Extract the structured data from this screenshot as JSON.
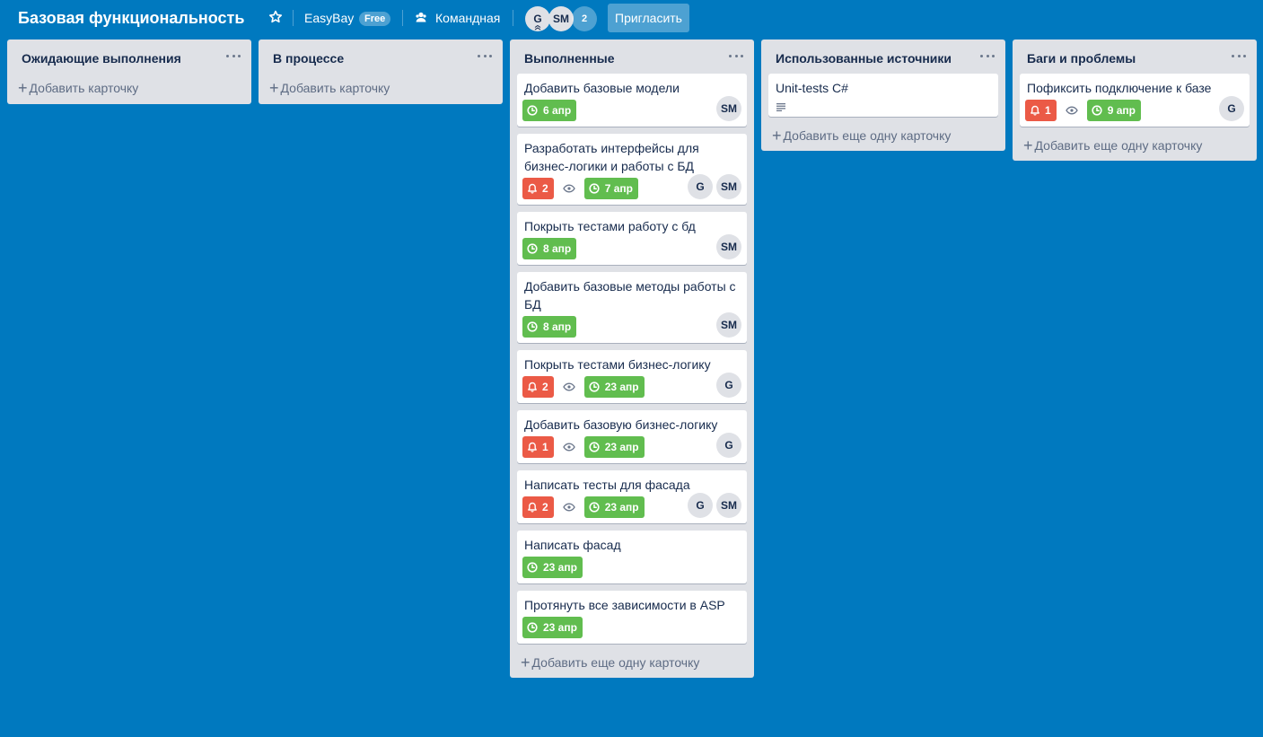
{
  "header": {
    "board_title": "Базовая функциональность",
    "star_icon": "star-icon",
    "team_name": "EasyBay",
    "team_badge": "Free",
    "visibility_icon": "team-visibility-icon",
    "visibility": "Командная",
    "members": [
      {
        "initials": "G"
      },
      {
        "initials": "SM"
      }
    ],
    "more_members": "2",
    "invite_label": "Пригласить"
  },
  "colors": {
    "background": "#0079bf",
    "list_bg": "#dfe1e6",
    "due_green": "#61bd4f",
    "notif_red": "#eb5a46"
  },
  "lists": [
    {
      "title": "Ожидающие выполнения",
      "add_label": "Добавить карточку",
      "cards": []
    },
    {
      "title": "В процессе",
      "add_label": "Добавить карточку",
      "cards": []
    },
    {
      "title": "Выполненные",
      "add_label": "Добавить еще одну карточку",
      "cards": [
        {
          "title": "Добавить базовые модели",
          "due": "6 апр",
          "members": [
            "SM"
          ]
        },
        {
          "title": "Разработать интерфейсы для бизнес-логики и работы с БД",
          "notifications": "2",
          "watch": true,
          "due": "7 апр",
          "members": [
            "G",
            "SM"
          ]
        },
        {
          "title": "Покрыть тестами работу с бд",
          "due": "8 апр",
          "members": [
            "SM"
          ]
        },
        {
          "title": "Добавить базовые методы работы с БД",
          "due": "8 апр",
          "members": [
            "SM"
          ]
        },
        {
          "title": "Покрыть тестами бизнес-логику",
          "notifications": "2",
          "watch": true,
          "due": "23 апр",
          "members": [
            "G"
          ]
        },
        {
          "title": "Добавить базовую бизнес-логику",
          "notifications": "1",
          "watch": true,
          "due": "23 апр",
          "members": [
            "G"
          ]
        },
        {
          "title": "Написать тесты для фасада",
          "notifications": "2",
          "watch": true,
          "due": "23 апр",
          "members": [
            "G",
            "SM"
          ]
        },
        {
          "title": "Написать фасад",
          "due": "23 апр",
          "members": []
        },
        {
          "title": "Протянуть все зависимости в ASP",
          "due": "23 апр",
          "members": []
        }
      ]
    },
    {
      "title": "Использованные источники",
      "add_label": "Добавить еще одну карточку",
      "cards": [
        {
          "title": "Unit-tests C#",
          "description": true,
          "members": []
        }
      ]
    },
    {
      "title": "Баги и проблемы",
      "add_label": "Добавить еще одну карточку",
      "cards": [
        {
          "title": "Пофиксить подключение к базе",
          "notifications": "1",
          "watch": true,
          "due": "9 апр",
          "members": [
            "G"
          ]
        }
      ]
    }
  ]
}
